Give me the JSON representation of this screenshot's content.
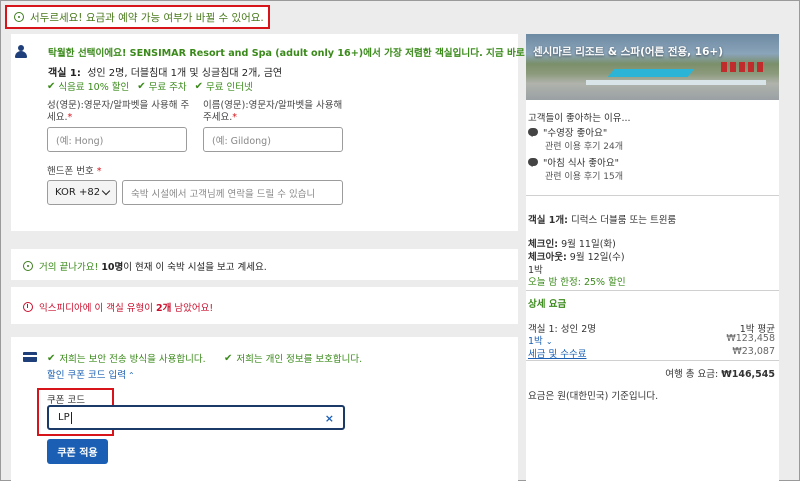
{
  "banner": {
    "text": "서두르세요! 요금과 예약 가능 여부가 바뀔 수 있어요."
  },
  "promo": {
    "text": "탁월한 선택이에요! SENSIMAR Resort and Spa (adult only 16+)에서 가장 저렴한 객실입니다. 지금 바로 예약하세요!"
  },
  "room": {
    "label": "객실 1:",
    "details": "성인 2명, 더블침대 1개 및 싱글침대 2개, 금연"
  },
  "perks": [
    "식음료 10% 할인",
    "무료 주차",
    "무료 인터넷"
  ],
  "form": {
    "last_name_label_1": "성(영문):영문자/알파벳을 사용해 주",
    "last_name_label_2": "세요.",
    "last_name_placeholder": "(예: Hong)",
    "first_name_label_1": "이름(영문):영문자/알파벳을 사용해",
    "first_name_label_2": "주세요.",
    "first_name_placeholder": "(예: Gildong)",
    "phone_label": "핸드폰 번호",
    "country_code": "KOR +82",
    "phone_placeholder": "숙박 시설에서 고객님께 연락을 드릴 수 있습니"
  },
  "alerts": {
    "viewing_prefix": "거의 끝나가요!",
    "viewing_count": "10명",
    "viewing_suffix": "이 현재 이 숙박 시설을 보고 계세요.",
    "urgency_prefix": "익스피디아에 이 객실 유형이",
    "urgency_count": "2개",
    "urgency_suffix": "남았어요!"
  },
  "payment": {
    "secure_1": "저희는 보안 전송 방식을 사용합니다.",
    "secure_2": "저희는 개인 정보를 보호합니다.",
    "coupon_link": "할인 쿠폰 코드 입력",
    "coupon_label": "쿠폰 코드",
    "coupon_value": "LP",
    "apply_label": "쿠폰 적용"
  },
  "sidebar": {
    "hotel_name": "센시마르 리조트 & 스파(어른 전용, 16+)",
    "reasons_title": "고객들이 좋아하는 이유...",
    "reviews": [
      {
        "quote": "\"수영장 좋아요\"",
        "count": "관련 이용 후기 24개"
      },
      {
        "quote": "\"아침 식사 좋아요\"",
        "count": "관련 이용 후기 15개"
      }
    ],
    "room_label": "객실 1개:",
    "room_type": "디럭스 더블룸 또는 트윈룸",
    "checkin_label": "체크인:",
    "checkin_date": "9월 11일(화)",
    "checkout_label": "체크아웃:",
    "checkout_date": "9월 12일(수)",
    "nights": "1박",
    "special": "오늘 밤 한정: 25% 할인",
    "price_header": "상세 요금",
    "price_room_label": "객실 1: 성인 2명",
    "price_avg_label": "1박 평균",
    "price_night_label": "1박",
    "price_night_value": "₩123,458",
    "tax_label": "세금 및 수수료",
    "tax_value": "₩23,087",
    "total_label": "여행 총 요금:",
    "total_value": "₩146,545",
    "currency_note": "요금은 원(대한민국) 기준입니다."
  },
  "colors": {
    "accent_green": "#3a8a1a",
    "link_blue": "#1a5fb4",
    "alert_red": "#d7141a",
    "brand_navy": "#1f3f7a"
  }
}
